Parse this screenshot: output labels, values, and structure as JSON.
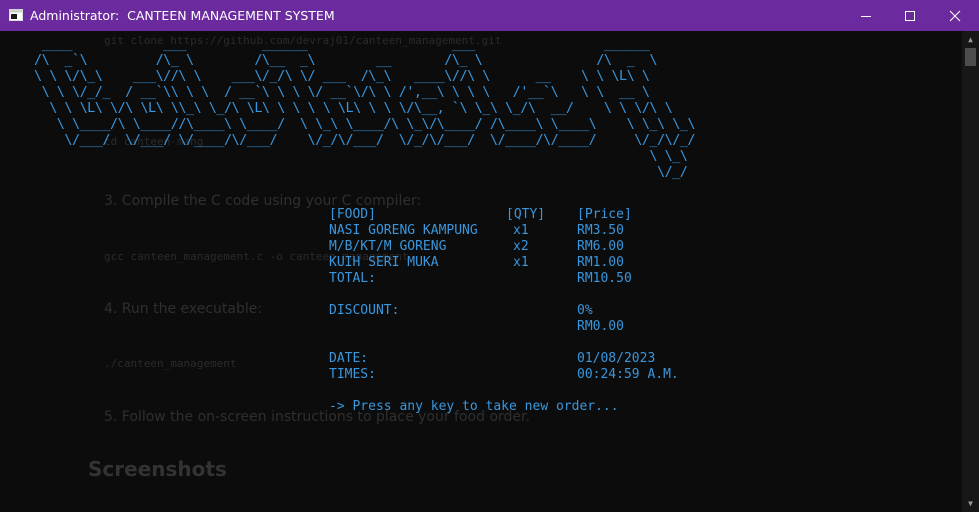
{
  "window": {
    "title": "Administrator:  CANTEEN MANAGEMENT SYSTEM"
  },
  "background_doc": {
    "clone_cmd": "git clone https://github.com/devraj01/canteen_management.git",
    "cd_cmd": "cd canteen-mang",
    "step3": "3. Compile the C code using your C compiler:",
    "compile_cmd": "gcc canteen_management.c -o canteen_management",
    "step4": "4. Run the executable:",
    "run_cmd": "./canteen_management",
    "step5": "5. Follow the on-screen instructions to place your food order.",
    "screenshots_heading": "Screenshots"
  },
  "banner_ascii": [
    " ____            ___          ______                   ___                 ______",
    "/\\  _`\\         /\\_ \\        /\\__  _\\        __       /\\_ \\               /\\  _  \\",
    "\\ \\ \\/\\_\\    ___\\//\\ \\    ___\\/_/\\ \\/ ___  /\\_\\   ____\\//\\ \\      __    \\ \\ \\L\\ \\",
    " \\ \\ \\/_/_  / __`\\\\ \\ \\  / __`\\ \\ \\ \\/ __`\\/\\ \\ /',__\\ \\ \\ \\   /'__`\\   \\ \\  __ \\",
    "  \\ \\ \\L\\ \\/\\ \\L\\ \\\\_\\ \\_/\\ \\L\\ \\ \\ \\ \\ \\L\\ \\ \\ \\/\\__, `\\ \\_\\ \\_/\\  __/    \\ \\ \\/\\ \\",
    "   \\ \\____/\\ \\____//\\____\\ \\____/  \\ \\_\\ \\____/\\ \\_\\/\\____/ /\\____\\ \\____\\    \\ \\_\\ \\_\\",
    "    \\/___/  \\/___/ \\/____/\\/___/    \\/_/\\/___/  \\/_/\\/___/  \\/____/\\/____/     \\/_/\\/_/",
    "                                                                                 \\ \\_\\",
    "                                                                                  \\/_/"
  ],
  "receipt": {
    "headers": {
      "food": "[FOOD]",
      "qty": "[QTY]",
      "price": "[Price]"
    },
    "items": [
      {
        "food": "NASI GORENG KAMPUNG",
        "qty": "x1",
        "price": "RM3.50"
      },
      {
        "food": "M/B/KT/M GORENG",
        "qty": "x2",
        "price": "RM6.00"
      },
      {
        "food": "KUIH SERI MUKA",
        "qty": "x1",
        "price": "RM1.00"
      }
    ],
    "total_label": "TOTAL:",
    "total_value": "RM10.50",
    "discount_label": "DISCOUNT:",
    "discount_percent": "0%",
    "discount_amount": "RM0.00",
    "date_label": "DATE:",
    "date_value": "01/08/2023",
    "time_label": "TIMES:",
    "time_value": "00:24:59 A.M.",
    "prompt": "-> Press any key to take new order..."
  },
  "colors": {
    "titlebar": "#6b2b9e",
    "console_bg": "#0c0c0c",
    "console_text": "#3a96dd"
  },
  "icons": {
    "app": "console-window-icon",
    "minimize": "minimize-icon",
    "maximize": "maximize-icon",
    "close": "close-icon"
  }
}
